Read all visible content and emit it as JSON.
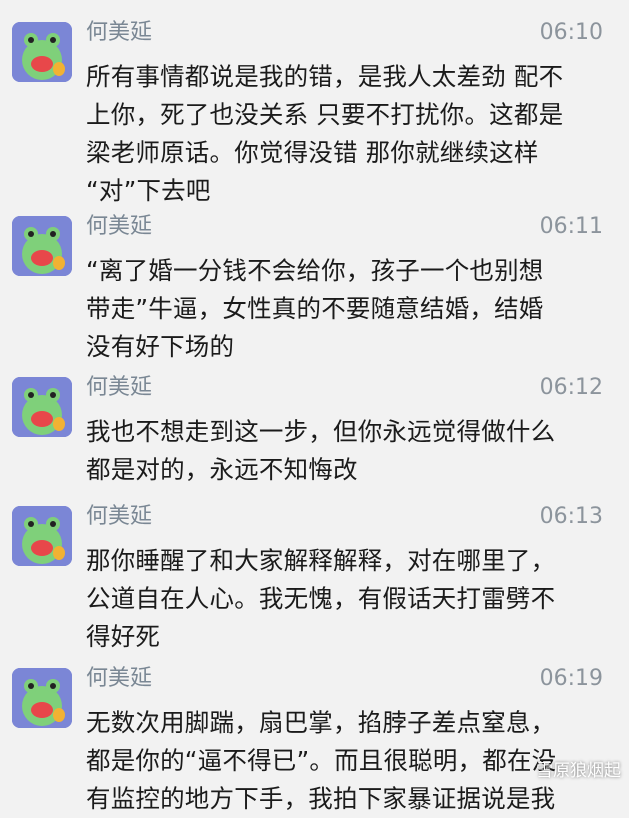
{
  "messages": [
    {
      "sender": "何美延",
      "time": "06:10",
      "text": "所有事情都说是我的错，是我人太差劲 配不\n上你，死了也没关系 只要不打扰你。这都是\n梁老师原话。你觉得没错 那你就继续这样\n“对”下去吧"
    },
    {
      "sender": "何美延",
      "time": "06:11",
      "text": "“离了婚一分钱不会给你，孩子一个也别想\n带走”牛逼，女性真的不要随意结婚，结婚\n没有好下场的"
    },
    {
      "sender": "何美延",
      "time": "06:12",
      "text": "我也不想走到这一步，但你永远觉得做什么\n都是对的，永远不知悔改"
    },
    {
      "sender": "何美延",
      "time": "06:13",
      "text": "那你睡醒了和大家解释解释，对在哪里了，\n公道自在人心。我无愧，有假话天打雷劈不\n得好死"
    },
    {
      "sender": "何美延",
      "time": "06:19",
      "text": "无数次用脚踹，扇巴掌，掐脖子差点窒息，\n都是你的“逼不得已”。而且很聪明，都在没\n有监控的地方下手，我拍下家暴证据说是我"
    }
  ],
  "watermark": "雪原狼烟起",
  "avatar_icon": "frog-cartoon-avatar-icon"
}
